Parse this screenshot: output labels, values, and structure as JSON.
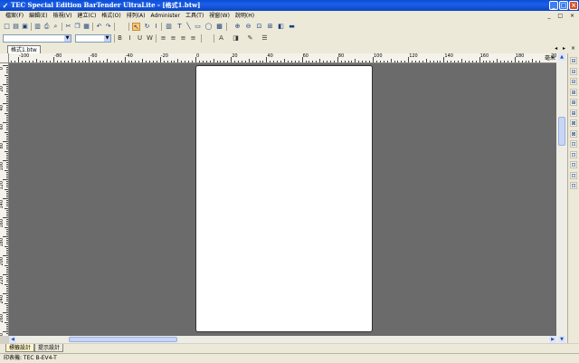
{
  "window": {
    "title": "TEC Special Edition BarTender UltraLite - [格式1.btw]"
  },
  "menu": [
    "檔案(F)",
    "編輯(E)",
    "檢視(V)",
    "建立(C)",
    "格式(O)",
    "排列(A)",
    "Administer",
    "工具(T)",
    "視窗(W)",
    "說明(H)"
  ],
  "toolbar1": [
    {
      "name": "new-icon",
      "glyph": "□"
    },
    {
      "name": "open-icon",
      "glyph": "▤"
    },
    {
      "name": "save-icon",
      "glyph": "▣"
    },
    {
      "name": "print-preview-icon",
      "glyph": "▥"
    },
    {
      "name": "print-icon",
      "glyph": "⎙"
    },
    {
      "name": "search-icon",
      "glyph": "⌕"
    },
    {
      "name": "cut-icon",
      "glyph": "✂"
    },
    {
      "name": "copy-icon",
      "glyph": "❐"
    },
    {
      "name": "paste-icon",
      "glyph": "▦"
    },
    {
      "name": "undo-icon",
      "glyph": "↶"
    },
    {
      "name": "redo-icon",
      "glyph": "↷"
    },
    {
      "name": "select-arrow-icon",
      "glyph": "↖"
    },
    {
      "name": "rotate-icon",
      "glyph": "↻"
    },
    {
      "name": "text-cursor-icon",
      "glyph": "I"
    },
    {
      "name": "barcode-icon",
      "glyph": "▥"
    },
    {
      "name": "text-icon",
      "glyph": "T"
    },
    {
      "name": "line-icon",
      "glyph": "╲"
    },
    {
      "name": "rectangle-icon",
      "glyph": "▭"
    },
    {
      "name": "ellipse-icon",
      "glyph": "◯"
    },
    {
      "name": "picture-icon",
      "glyph": "▩"
    },
    {
      "name": "zoom-in-icon",
      "glyph": "⊕"
    },
    {
      "name": "zoom-out-icon",
      "glyph": "⊖"
    },
    {
      "name": "zoom-fit-icon",
      "glyph": "⊡"
    },
    {
      "name": "actual-size-icon",
      "glyph": "⊞"
    },
    {
      "name": "database-icon",
      "glyph": "◧"
    },
    {
      "name": "printer-setup-icon",
      "glyph": "▬"
    }
  ],
  "toolbar2": [
    {
      "name": "bold-icon",
      "glyph": "B"
    },
    {
      "name": "italic-icon",
      "glyph": "I"
    },
    {
      "name": "underline-icon",
      "glyph": "U"
    },
    {
      "name": "wordwrap-icon",
      "glyph": "W"
    },
    {
      "name": "align-left-icon",
      "glyph": "≡"
    },
    {
      "name": "align-center-icon",
      "glyph": "≡"
    },
    {
      "name": "align-right-icon",
      "glyph": "≡"
    },
    {
      "name": "align-justify-icon",
      "glyph": "≡"
    },
    {
      "name": "font-color-icon",
      "glyph": "A"
    },
    {
      "name": "fill-color-icon",
      "glyph": "◨"
    },
    {
      "name": "line-color-icon",
      "glyph": "✎"
    },
    {
      "name": "line-style-icon",
      "glyph": "☰"
    }
  ],
  "doc_tab": "格式1.btw",
  "ruler": {
    "unit": "毫米",
    "h_labels": [
      "-100",
      "-80",
      "-60",
      "-40",
      "-20",
      "0",
      "20",
      "40",
      "60",
      "80",
      "100",
      "120",
      "140",
      "160",
      "180",
      "200"
    ],
    "v_labels": [
      "0",
      "20",
      "40",
      "60",
      "80",
      "100",
      "120",
      "140",
      "160",
      "180",
      "200",
      "220",
      "240",
      "260",
      "280"
    ]
  },
  "bottom_tabs": [
    "標籤設計",
    "提示設計"
  ],
  "status": {
    "printer": "印表機: TEC B-EV4-T"
  }
}
